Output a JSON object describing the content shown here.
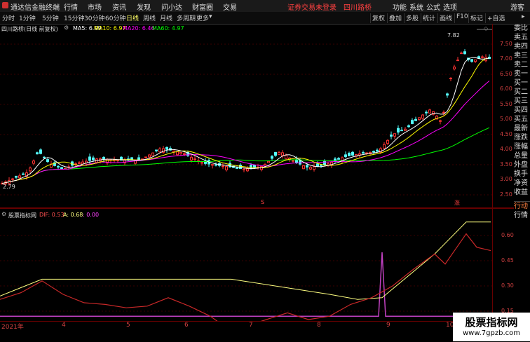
{
  "menubar": {
    "app_title": "通达信金融终端",
    "items": [
      "行情",
      "市场",
      "资讯",
      "发现",
      "问小达",
      "财富圈",
      "交易"
    ],
    "login_status": "证券交易未登录",
    "stock_name": "四川路桥",
    "right_items": [
      "功能",
      "系统",
      "公式",
      "选项"
    ],
    "user": "游客"
  },
  "periodbar": {
    "periods": [
      "分时",
      "1分钟",
      "5分钟",
      "15分钟",
      "30分钟",
      "60分钟",
      "日线",
      "周线",
      "月线",
      "多周期",
      "更多"
    ],
    "active": "日线",
    "tools": [
      "复权",
      "叠加",
      "多股",
      "统计",
      "画线",
      "F10",
      "标记",
      "+自选"
    ]
  },
  "main_chart": {
    "title": "四川路桥(日线 前复权)",
    "ma5_label": "MA5: 6.99",
    "ma10_label": "MA10: 6.97",
    "ma20_label": "MA20: 6.46",
    "ma60_label": "MA60: 4.97",
    "high_label": "7.82",
    "low_label": "2.79",
    "yticks": [
      "7.50",
      "7.00",
      "6.50",
      "6.00",
      "5.50",
      "5.00",
      "4.50",
      "4.00",
      "3.50",
      "3.00",
      "2.50"
    ],
    "markers": [
      "S",
      "涨"
    ]
  },
  "indicator": {
    "title": "股票指标网",
    "dif_label": "DIF: 0.53",
    "a_label": "A: 0.68",
    "b_label": ": 0.00",
    "yticks": [
      "0.60",
      "0.45",
      "0.30",
      "0.15"
    ]
  },
  "xaxis": [
    "2021年",
    "4",
    "5",
    "6",
    "7",
    "8",
    "9",
    "10"
  ],
  "right_panel": [
    "委比",
    "卖五",
    "卖四",
    "卖三",
    "卖二",
    "卖一",
    "买一",
    "买二",
    "买三",
    "买四",
    "买五",
    "最新",
    "涨跌",
    "涨幅",
    "总量",
    "外盘",
    "换手",
    "净资",
    "收益",
    "",
    "行动",
    "行情"
  ],
  "watermark": {
    "title": "股票指标网",
    "url": "www.7gpzb.com"
  },
  "colors": {
    "up": "#ff3232",
    "down": "#54fcfc",
    "ma5": "#ffffff",
    "ma10": "#ffff00",
    "ma20": "#ff00ff",
    "ma60": "#00ff00",
    "dif": "#c82828",
    "a_line": "#ffff80",
    "b_line": "#c040c0"
  }
}
